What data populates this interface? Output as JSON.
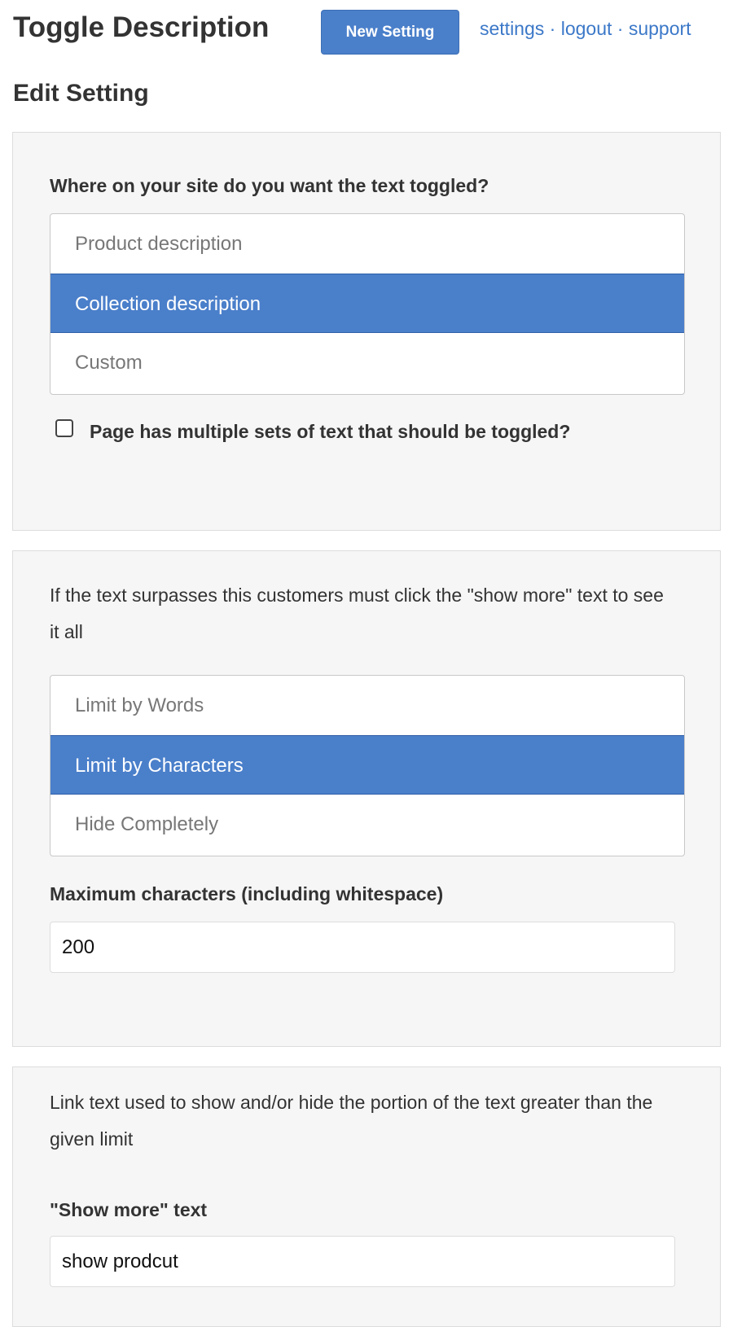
{
  "header": {
    "title": "Toggle Description",
    "new_button": "New Setting",
    "links": [
      "settings",
      "logout",
      "support"
    ],
    "separator": "·"
  },
  "page_title": "Edit Setting",
  "section1": {
    "label": "Where on your site do you want the text toggled?",
    "options": [
      "Product description",
      "Collection description",
      "Custom"
    ],
    "selected": "Collection description",
    "checkbox_label": "Page has multiple sets of text that should be toggled?",
    "checkbox_checked": false
  },
  "section2": {
    "description": "If the text surpasses this customers must click the \"show more\" text to see it all",
    "options": [
      "Limit by Words",
      "Limit by Characters",
      "Hide Completely"
    ],
    "selected": "Limit by Characters",
    "max_label": "Maximum characters (including whitespace)",
    "max_value": "200"
  },
  "section3": {
    "description": "Link text used to show and/or hide the portion of the text greater than the given limit",
    "show_more_label": "\"Show more\" text",
    "show_more_value": "show prodcut"
  },
  "colors": {
    "accent": "#4a7fca",
    "link": "#3b78c8"
  }
}
